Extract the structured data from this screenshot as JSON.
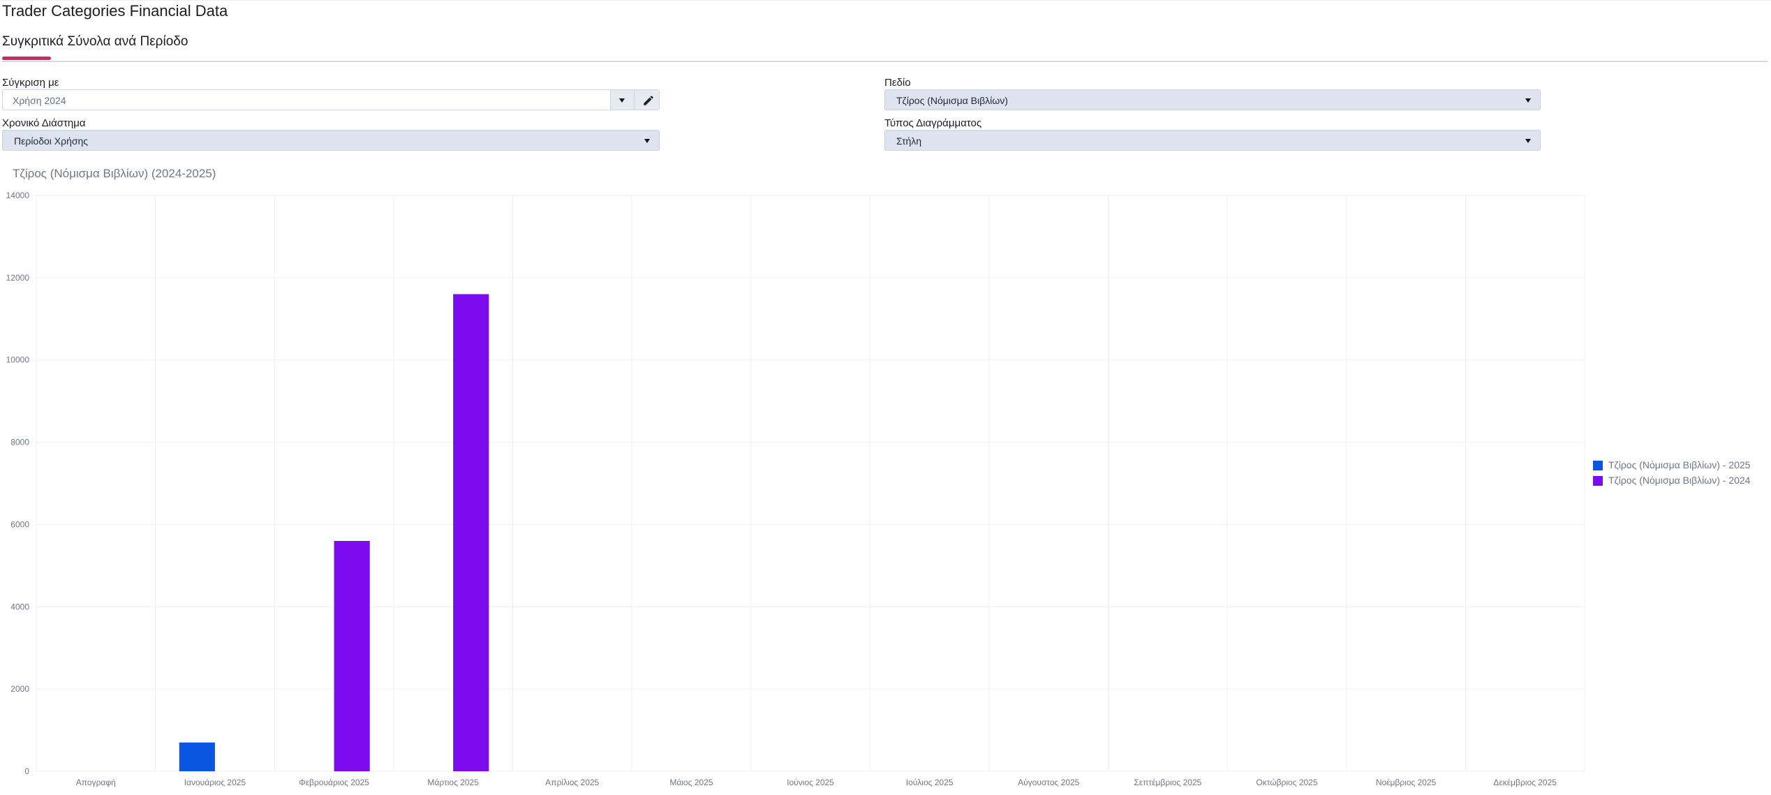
{
  "app_title": "Trader Categories Financial Data",
  "tabs": [
    {
      "label": "Συγκριτικά Σύνολα ανά Περίοδο"
    }
  ],
  "filters": {
    "compare_with": {
      "label": "Σύγκριση με",
      "value": "Χρήση 2024"
    },
    "field": {
      "label": "Πεδίο",
      "value": "Τζίρος (Νόμισμα Βιβλίων)"
    },
    "time_range": {
      "label": "Χρονικό Διάστημα",
      "value": "Περίοδοι Χρήσης"
    },
    "chart_type": {
      "label": "Τύπος Διαγράμματος",
      "value": "Στήλη"
    }
  },
  "icons": {
    "dropdown": "chevron-down-icon",
    "edit": "pencil-icon"
  },
  "colors": {
    "accent": "#c72c6b",
    "series_2025": "#0b57e3",
    "series_2024": "#7c0cef",
    "grid": "#eef0f4",
    "axis_text": "#6e7788"
  },
  "chart_data": {
    "type": "bar",
    "title": "Τζίρος (Νόμισμα Βιβλίων) (2024-2025)",
    "categories": [
      "Απογραφή",
      "Ιανουάριος 2025",
      "Φεβρουάριος 2025",
      "Μάρτιος 2025",
      "Απρίλιος 2025",
      "Μάιος 2025",
      "Ιούνιος 2025",
      "Ιούλιος 2025",
      "Αύγουστος 2025",
      "Σεπτέμβριος 2025",
      "Οκτώβριος 2025",
      "Νοέμβριος 2025",
      "Δεκέμβριος 2025"
    ],
    "series": [
      {
        "name": "Τζίρος (Νόμισμα Βιβλίων) - 2025",
        "color": "#0b57e3",
        "values": [
          0,
          700,
          0,
          0,
          0,
          0,
          0,
          0,
          0,
          0,
          0,
          0,
          0
        ]
      },
      {
        "name": "Τζίρος (Νόμισμα Βιβλίων) - 2024",
        "color": "#7c0cef",
        "values": [
          0,
          0,
          5600,
          11600,
          0,
          0,
          0,
          0,
          0,
          0,
          0,
          0,
          0
        ]
      }
    ],
    "ylim": [
      0,
      14000
    ],
    "yticks": [
      0,
      2000,
      4000,
      6000,
      8000,
      10000,
      12000,
      14000
    ],
    "grid": true,
    "legend_position": "right"
  }
}
